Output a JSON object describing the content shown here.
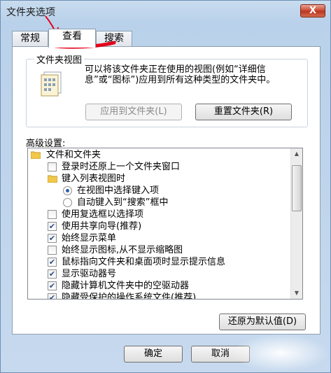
{
  "window": {
    "title": "文件夹选项",
    "close_glyph": "X"
  },
  "tabs": [
    "常规",
    "查看",
    "搜索"
  ],
  "folder_views": {
    "title": "文件夹视图",
    "description": "可以将该文件夹正在使用的视图(例如“详细信息”或“图标”)应用到所有这种类型的文件夹中。",
    "apply_button": "应用到文件夹(L)",
    "reset_button": "重置文件夹(R)"
  },
  "advanced": {
    "label": "高级设置:",
    "items": [
      {
        "type": "folder",
        "label": "文件和文件夹"
      },
      {
        "type": "checkbox",
        "checked": false,
        "label": "登录时还原上一个文件夹窗口"
      },
      {
        "type": "folder",
        "label": "键入列表视图时"
      },
      {
        "type": "radio",
        "checked": true,
        "label": "在视图中选择键入项"
      },
      {
        "type": "radio",
        "checked": false,
        "label": "自动键入到“搜索”框中"
      },
      {
        "type": "checkbox",
        "checked": false,
        "label": "使用复选框以选择项"
      },
      {
        "type": "checkbox",
        "checked": true,
        "label": "使用共享向导(推荐)"
      },
      {
        "type": "checkbox",
        "checked": true,
        "label": "始终显示菜单"
      },
      {
        "type": "checkbox",
        "checked": false,
        "label": "始终显示图标,从不显示缩略图"
      },
      {
        "type": "checkbox",
        "checked": true,
        "label": "鼠标指向文件夹和桌面项时显示提示信息"
      },
      {
        "type": "checkbox",
        "checked": true,
        "label": "显示驱动器号"
      },
      {
        "type": "checkbox",
        "checked": true,
        "label": "隐藏计算机文件夹中的空驱动器"
      },
      {
        "type": "checkbox",
        "checked": true,
        "label": "隐藏受保护的操作系统文件(推荐)"
      }
    ],
    "restore_button": "还原为默认值(D)"
  },
  "footer": {
    "ok_button": "确定",
    "cancel_button": "取消"
  },
  "annotation_color": "#e3001b"
}
